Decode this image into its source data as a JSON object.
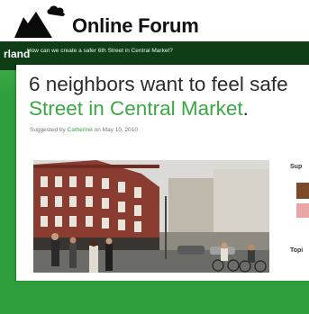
{
  "brand": {
    "title": "Online Forum",
    "icon": "mountain-cloud-logo-icon"
  },
  "screenshot": {
    "site_logo_text": "rland",
    "question": "How can we create a safer 6th Street in Central Market?",
    "headline_line1": "6 neighbors want to feel safe",
    "headline_line2": "Street in Central Market",
    "headline_period": ".",
    "suggested_prefix": "Suggested by",
    "suggested_author": "Catherine",
    "suggested_date": "on May 10, 2010",
    "sidebar_supporters_label": "Sup",
    "sidebar_topics_label": "Topi"
  },
  "colors": {
    "green_accent": "#3aa844",
    "dark_green": "#0f3d16"
  }
}
